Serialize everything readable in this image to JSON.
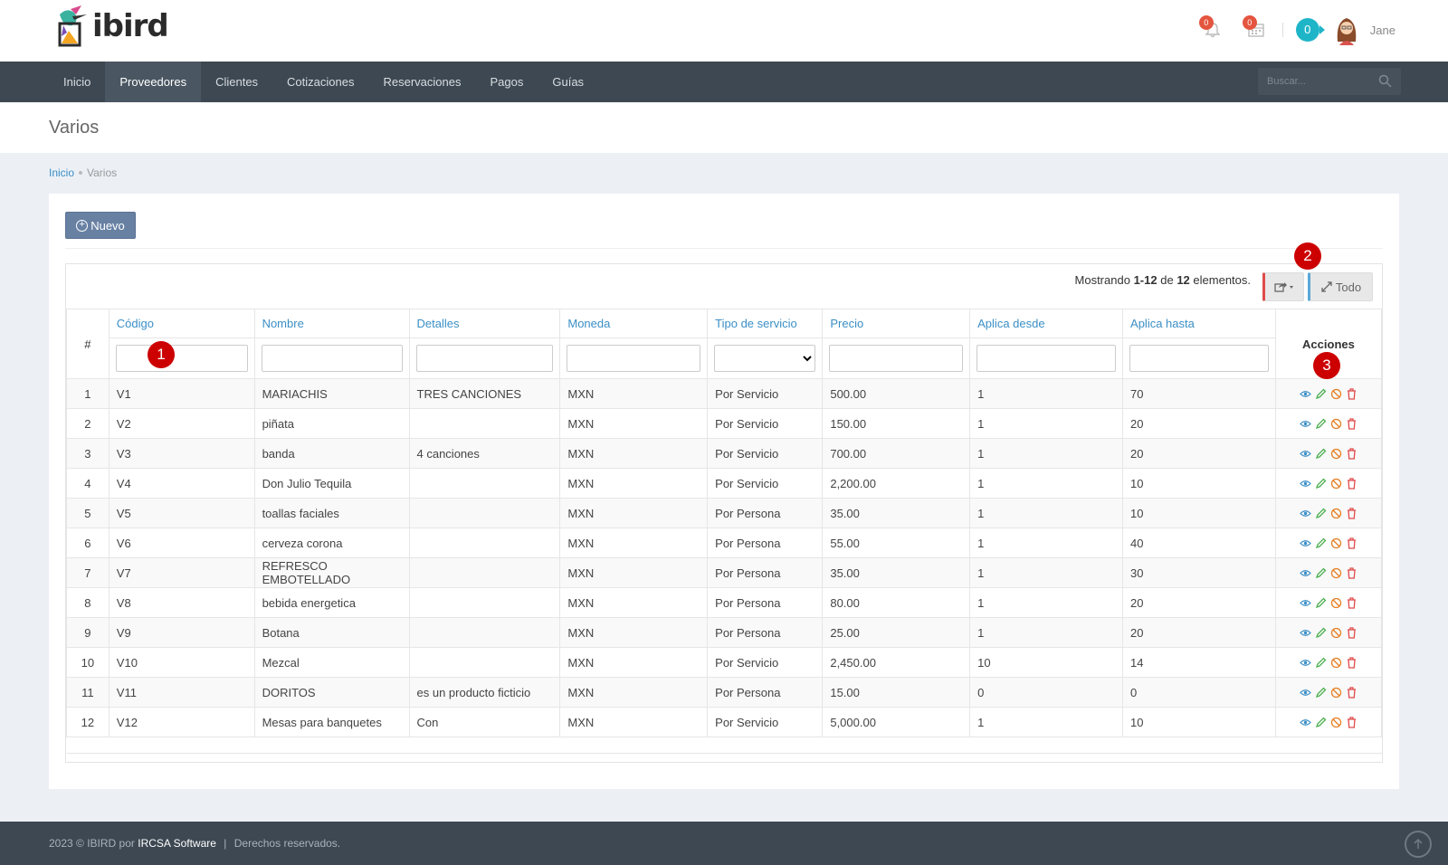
{
  "app": {
    "logo_text": "ibird"
  },
  "header": {
    "notifications_count": "0",
    "calendar_count": "0",
    "credits": "0",
    "user_name": "Jane"
  },
  "nav": {
    "items": [
      "Inicio",
      "Proveedores",
      "Clientes",
      "Cotizaciones",
      "Reservaciones",
      "Pagos",
      "Guías"
    ],
    "active": "Proveedores",
    "search_placeholder": "Buscar..."
  },
  "page": {
    "title": "Varios"
  },
  "breadcrumb": {
    "home": "Inicio",
    "current": "Varios"
  },
  "toolbar": {
    "new_label": "Nuevo",
    "all_label": "Todo"
  },
  "summary": {
    "prefix": "Mostrando",
    "range": "1-12",
    "of": "de",
    "total": "12",
    "suffix": "elementos."
  },
  "table": {
    "columns": [
      "#",
      "Código",
      "Nombre",
      "Detalles",
      "Moneda",
      "Tipo de servicio",
      "Precio",
      "Aplica desde",
      "Aplica hasta",
      "Acciones"
    ],
    "rows": [
      [
        "1",
        "V1",
        "MARIACHIS",
        "TRES CANCIONES",
        "MXN",
        "Por Servicio",
        "500.00",
        "1",
        "70"
      ],
      [
        "2",
        "V2",
        "piñata",
        "",
        "MXN",
        "Por Servicio",
        "150.00",
        "1",
        "20"
      ],
      [
        "3",
        "V3",
        "banda",
        "4 canciones",
        "MXN",
        "Por Servicio",
        "700.00",
        "1",
        "20"
      ],
      [
        "4",
        "V4",
        "Don Julio Tequila",
        "",
        "MXN",
        "Por Servicio",
        "2,200.00",
        "1",
        "10"
      ],
      [
        "5",
        "V5",
        "toallas faciales",
        "",
        "MXN",
        "Por Persona",
        "35.00",
        "1",
        "10"
      ],
      [
        "6",
        "V6",
        "cerveza corona",
        "",
        "MXN",
        "Por Persona",
        "55.00",
        "1",
        "40"
      ],
      [
        "7",
        "V7",
        "REFRESCO EMBOTELLADO",
        "",
        "MXN",
        "Por Persona",
        "35.00",
        "1",
        "30"
      ],
      [
        "8",
        "V8",
        "bebida energetica",
        "",
        "MXN",
        "Por Persona",
        "80.00",
        "1",
        "20"
      ],
      [
        "9",
        "V9",
        "Botana",
        "",
        "MXN",
        "Por Persona",
        "25.00",
        "1",
        "20"
      ],
      [
        "10",
        "V10",
        "Mezcal",
        "",
        "MXN",
        "Por Servicio",
        "2,450.00",
        "10",
        "14"
      ],
      [
        "11",
        "V11",
        "DORITOS",
        "es un producto ficticio",
        "MXN",
        "Por Persona",
        "15.00",
        "0",
        "0"
      ],
      [
        "12",
        "V12",
        "Mesas para banquetes",
        "Con",
        "MXN",
        "Por Servicio",
        "5,000.00",
        "1",
        "10"
      ]
    ]
  },
  "markers": [
    "1",
    "2",
    "3"
  ],
  "footer": {
    "year_text": "2023 © IBIRD por",
    "company": "IRCSA Software",
    "sep": "|",
    "rights": "Derechos reservados."
  },
  "colors": {
    "nav_bg": "#3d4852",
    "link": "#3b8fc6",
    "primary_button": "#6881a3",
    "marker": "#cc0000"
  }
}
